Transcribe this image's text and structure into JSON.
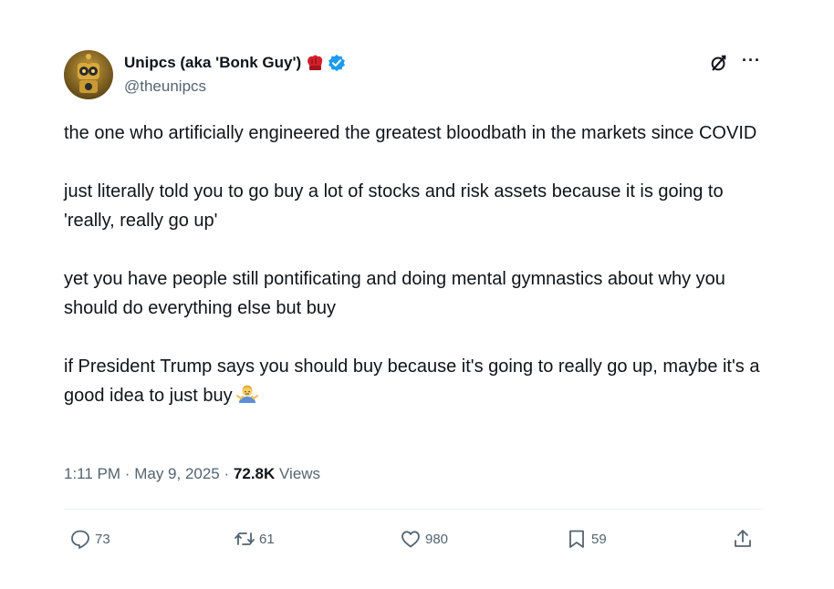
{
  "author": {
    "display_name": "Unipcs (aka 'Bonk Guy')",
    "name_emoji": "boxing-glove-icon",
    "verified": true,
    "handle": "@theunipcs"
  },
  "tweet": {
    "paragraphs": [
      "the one who artificially engineered the greatest bloodbath in the markets since COVID",
      "just literally told you to go buy a lot of stocks and risk assets because it is going to 'really, really go up'",
      "yet you have people still pontificating and doing mental gymnastics about why you should do everything else but buy",
      "if President Trump says you should buy because it's going to really go up, maybe it's a good idea to just buy"
    ],
    "trailing_emoji": "man-shrugging-emoji-icon"
  },
  "meta": {
    "time": "1:11 PM",
    "separator": "·",
    "date": "May 9, 2025",
    "views_count": "72.8K",
    "views_label": "Views"
  },
  "actions": {
    "replies": "73",
    "reposts": "61",
    "likes": "980",
    "bookmarks": "59"
  },
  "colors": {
    "text": "#0f1419",
    "secondary": "#536471",
    "verified": "#1d9bf0",
    "divider": "#eff3f4"
  }
}
